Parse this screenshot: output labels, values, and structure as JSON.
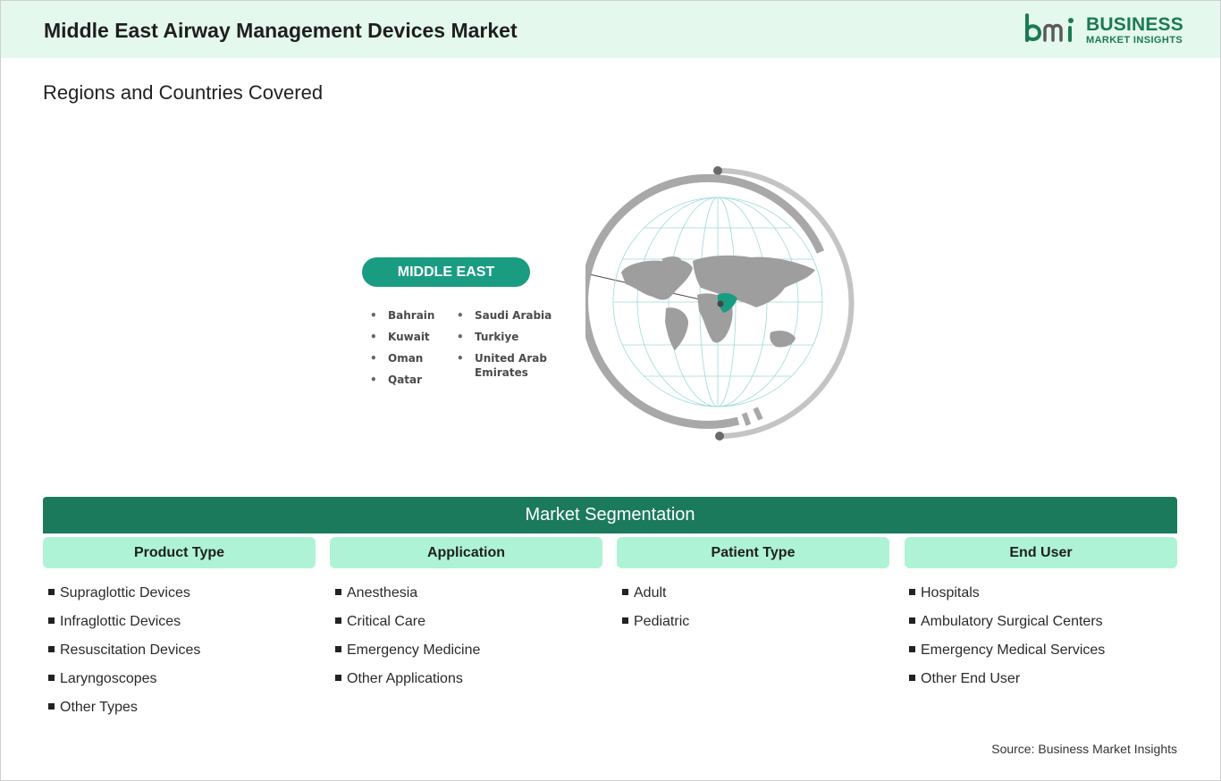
{
  "header": {
    "title": "Middle East Airway Management Devices Market",
    "logo": {
      "icon": "bmi-logo-mark",
      "line1": "BUSINESS",
      "line2": "MARKET INSIGHTS",
      "color": "#1b7a52"
    }
  },
  "subtitle": "Regions and Countries Covered",
  "region": {
    "name": "MIDDLE EAST",
    "accent": "#1a9c82",
    "countries_col1": [
      "Bahrain",
      "Kuwait",
      "Oman",
      "Qatar"
    ],
    "countries_col2": [
      "Saudi Arabia",
      "Turkiye",
      "United Arab Emirates"
    ],
    "globe_icon": "world-globe-icon"
  },
  "segmentation": {
    "title": "Market Segmentation",
    "bar_color": "#1b7a5b",
    "header_color": "#aef3d5",
    "columns": [
      {
        "header": "Product Type",
        "items": [
          "Supraglottic Devices",
          "Infraglottic Devices",
          "Resuscitation Devices",
          "Laryngoscopes",
          "Other Types"
        ]
      },
      {
        "header": "Application",
        "items": [
          "Anesthesia",
          "Critical Care",
          "Emergency Medicine",
          "Other Applications"
        ]
      },
      {
        "header": "Patient Type",
        "items": [
          "Adult",
          "Pediatric"
        ]
      },
      {
        "header": "End User",
        "items": [
          "Hospitals",
          "Ambulatory Surgical Centers",
          "Emergency Medical Services",
          "Other End User"
        ]
      }
    ]
  },
  "source": "Source: Business Market Insights"
}
